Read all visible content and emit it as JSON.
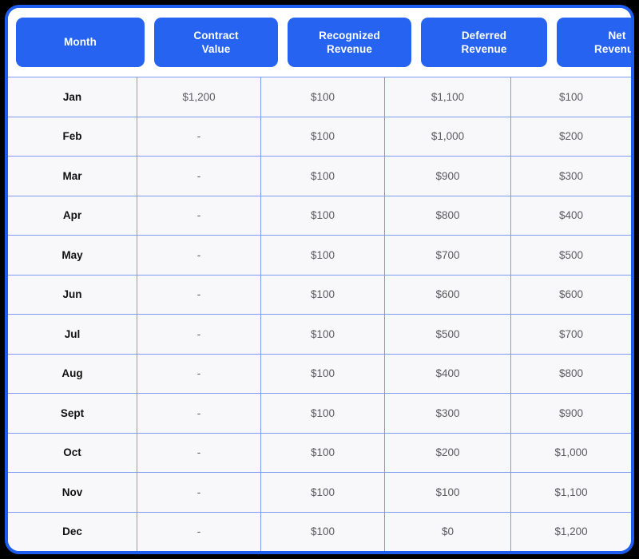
{
  "table": {
    "columns": [
      {
        "id": "month",
        "lines": [
          "Month"
        ]
      },
      {
        "id": "contract-value",
        "lines": [
          "Contract",
          "Value"
        ]
      },
      {
        "id": "recognized-revenue",
        "lines": [
          "Recognized",
          "Revenue"
        ]
      },
      {
        "id": "deferred-revenue",
        "lines": [
          "Deferred",
          "Revenue"
        ]
      },
      {
        "id": "net-revenue",
        "lines": [
          "Net",
          "Revenue"
        ]
      }
    ],
    "rows": [
      {
        "month": "Jan",
        "contract_value": "$1,200",
        "recognized_revenue": "$100",
        "deferred_revenue": "$1,100",
        "net_revenue": "$100"
      },
      {
        "month": "Feb",
        "contract_value": "-",
        "recognized_revenue": "$100",
        "deferred_revenue": "$1,000",
        "net_revenue": "$200"
      },
      {
        "month": "Mar",
        "contract_value": "-",
        "recognized_revenue": "$100",
        "deferred_revenue": "$900",
        "net_revenue": "$300"
      },
      {
        "month": "Apr",
        "contract_value": "-",
        "recognized_revenue": "$100",
        "deferred_revenue": "$800",
        "net_revenue": "$400"
      },
      {
        "month": "May",
        "contract_value": "-",
        "recognized_revenue": "$100",
        "deferred_revenue": "$700",
        "net_revenue": "$500"
      },
      {
        "month": "Jun",
        "contract_value": "-",
        "recognized_revenue": "$100",
        "deferred_revenue": "$600",
        "net_revenue": "$600"
      },
      {
        "month": "Jul",
        "contract_value": "-",
        "recognized_revenue": "$100",
        "deferred_revenue": "$500",
        "net_revenue": "$700"
      },
      {
        "month": "Aug",
        "contract_value": "-",
        "recognized_revenue": "$100",
        "deferred_revenue": "$400",
        "net_revenue": "$800"
      },
      {
        "month": "Sept",
        "contract_value": "-",
        "recognized_revenue": "$100",
        "deferred_revenue": "$300",
        "net_revenue": "$900"
      },
      {
        "month": "Oct",
        "contract_value": "-",
        "recognized_revenue": "$100",
        "deferred_revenue": "$200",
        "net_revenue": "$1,000"
      },
      {
        "month": "Nov",
        "contract_value": "-",
        "recognized_revenue": "$100",
        "deferred_revenue": "$100",
        "net_revenue": "$1,100"
      },
      {
        "month": "Dec",
        "contract_value": "-",
        "recognized_revenue": "$100",
        "deferred_revenue": "$0",
        "net_revenue": "$1,200"
      }
    ]
  },
  "colors": {
    "header_blue": "#2563f0",
    "border_blue": "#1d5df0",
    "grid_blue": "#7d9cf0",
    "cell_background": "#f8f8fa",
    "page_background": "#000000",
    "month_text": "#111111",
    "value_text": "#5c5c60"
  }
}
